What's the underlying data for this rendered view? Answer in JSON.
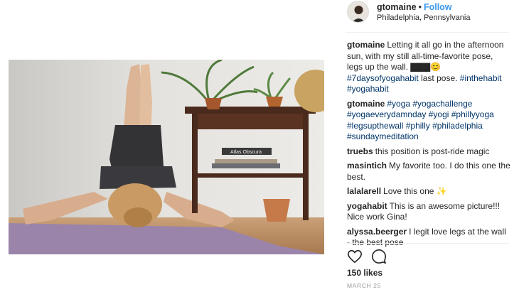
{
  "post": {
    "username": "gtomaine",
    "separator": "•",
    "follow_label": "Follow",
    "location": "Philadelphia, Pennsylvania",
    "likes": "150 likes",
    "date": "MARCH 25"
  },
  "photo": {
    "book_label": "Atlas Obscura"
  },
  "comments": [
    {
      "user": "gtomaine",
      "text": "Letting it all go in the afternoon sun, with my still all-time-favorite pose, legs up the wall. ",
      "emoji": "▇▇▇😊",
      "tags": "#7daysofyogahabit",
      "text2": " last pose. ",
      "tags2": "#inthehabit #yogahabit"
    },
    {
      "user": "gtomaine",
      "tags": "#yoga #yogachallenge #yogaeverydamnday #yogi #phillyyoga #legsupthewall #philly #philadelphia #sundaymeditation"
    },
    {
      "user": "truebs",
      "text": "this position is post-ride magic"
    },
    {
      "user": "masintich",
      "text": "My favorite too. I do this one the best."
    },
    {
      "user": "lalalarell",
      "text": "Love this one ✨"
    },
    {
      "user": "yogahabit",
      "text": "This is an awesome picture!!! Nice work Gina!"
    },
    {
      "user": "alyssa.beerger",
      "text": "I legit love legs at the wall - the best pose"
    }
  ],
  "icons": {
    "like": "heart-icon",
    "comment": "comment-icon"
  },
  "colors": {
    "link": "#003569",
    "follow": "#3897f0",
    "mat": "#9b84aa"
  }
}
